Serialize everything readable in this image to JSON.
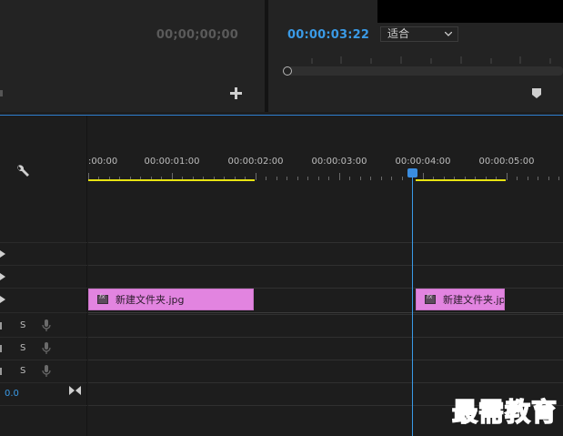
{
  "source_monitor": {
    "timecode": "00;00;00;00"
  },
  "program_monitor": {
    "timecode": "00:00:03:22",
    "zoom_select": {
      "value": "适合"
    }
  },
  "timeline": {
    "ruler_labels": [
      ":00:00",
      "00:00:01:00",
      "00:00:02:00",
      "00:00:03:00",
      "00:00:04:00",
      "00:00:05:00"
    ],
    "clips": [
      {
        "name": "新建文件夹.jpg"
      },
      {
        "name": "新建文件夹.jp"
      }
    ],
    "audio_tracks": [
      {
        "solo_label": "S"
      },
      {
        "solo_label": "S"
      },
      {
        "solo_label": "S"
      }
    ],
    "master_value": "0.0",
    "accent_color": "#3a9ae6",
    "clip_color": "#e284e0",
    "work_area_color": "#e7e312"
  },
  "watermark": "最需教育"
}
